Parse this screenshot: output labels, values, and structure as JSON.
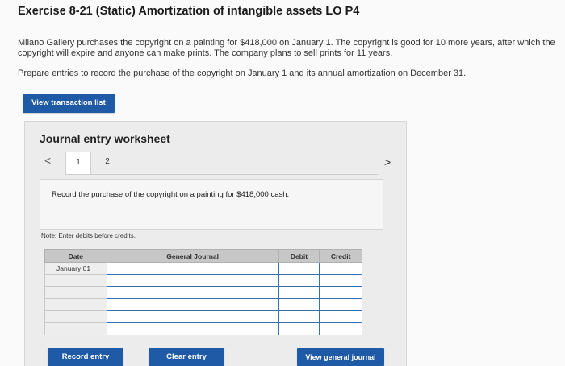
{
  "header": {
    "title": "Exercise 8-21 (Static) Amortization of intangible assets LO P4"
  },
  "problem": {
    "paragraph1": "Milano Gallery purchases the copyright on a painting for $418,000 on January 1. The copyright is good for 10 more years, after which the copyright will expire and anyone can make prints. The company plans to sell prints for 11 years.",
    "paragraph2": "Prepare entries to record the purchase of the copyright on January 1 and its annual amortization on December 31."
  },
  "buttons": {
    "view_transaction_list": "View transaction list",
    "record_entry": "Record entry",
    "clear_entry": "Clear entry",
    "view_general_journal": "View general journal"
  },
  "worksheet": {
    "title": "Journal entry worksheet",
    "prev_icon": "<",
    "next_icon": ">",
    "tabs": [
      "1",
      "2"
    ],
    "instruction": "Record the purchase of the copyright on a painting for $418,000 cash.",
    "note": "Note: Enter debits before credits."
  },
  "journal": {
    "headers": {
      "date": "Date",
      "general_journal": "General Journal",
      "debit": "Debit",
      "credit": "Credit"
    },
    "first_date": "January 01"
  },
  "colors": {
    "accent": "#1f5aa6"
  }
}
